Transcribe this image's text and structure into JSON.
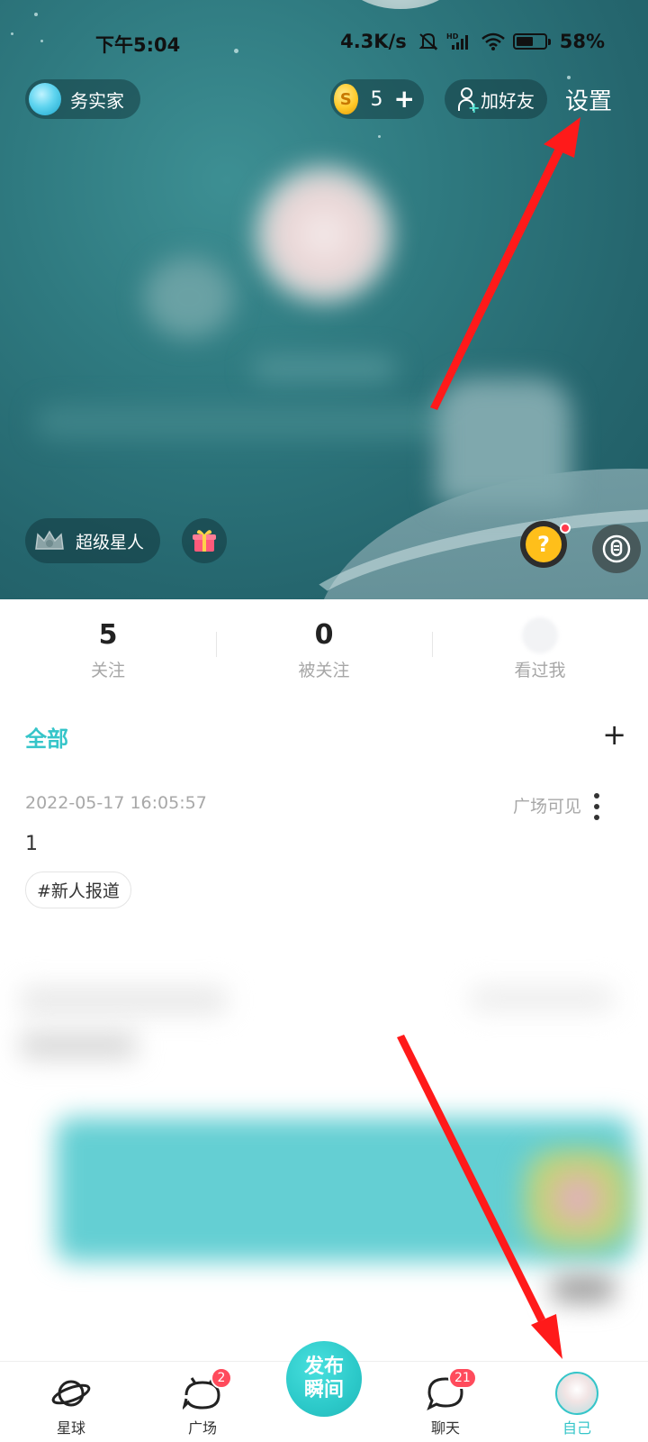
{
  "status_bar": {
    "time": "下午5:04",
    "net_speed": "4.3K/s",
    "battery": "58%",
    "icons": [
      "mute-icon",
      "hd-signal-icon",
      "wifi-icon",
      "battery-icon"
    ]
  },
  "header": {
    "nickname": "务实家",
    "coins": "5",
    "coin_symbol": "S",
    "coin_plus": "+",
    "add_friend_label": "加好友",
    "settings_label": "设置",
    "vip_label": "超级星人"
  },
  "stats": [
    {
      "value": "5",
      "label": "关注"
    },
    {
      "value": "0",
      "label": "被关注"
    },
    {
      "label": "看过我"
    }
  ],
  "feed": {
    "tab_label": "全部",
    "add_symbol": "+",
    "post": {
      "timestamp": "2022-05-17 16:05:57",
      "visibility": "广场可见",
      "body": "1",
      "tag": "#新人报道"
    }
  },
  "bottom_nav": {
    "items": [
      {
        "label": "星球",
        "icon": "planet-icon"
      },
      {
        "label": "广场",
        "icon": "plaza-icon",
        "badge": "2"
      },
      {
        "label": "聊天",
        "icon": "chat-icon",
        "badge": "21"
      },
      {
        "label": "自己",
        "icon": "avatar-icon"
      }
    ],
    "publish_label_line1": "发布",
    "publish_label_line2": "瞬间",
    "active_index": 3
  },
  "colors": {
    "accent": "#35c5c9",
    "badge": "#ff4b5c",
    "annotation_arrow": "#ff1a1a"
  }
}
